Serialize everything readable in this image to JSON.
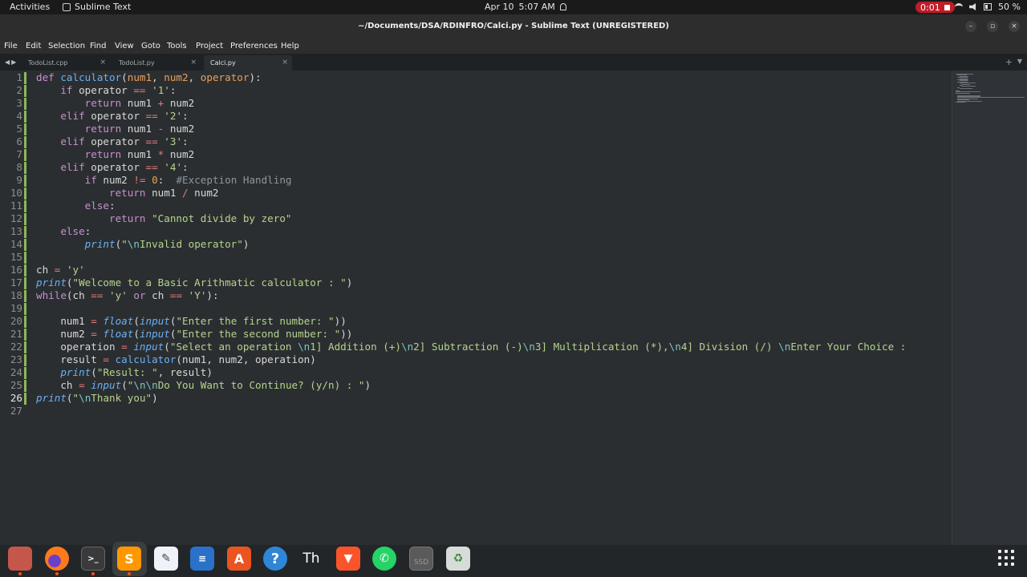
{
  "topbar": {
    "activities": "Activities",
    "app_name": "Sublime Text",
    "date": "Apr 10",
    "time": "5:07 AM",
    "recording_time": "0:01",
    "battery": "50 %",
    "colors": {
      "recording": "#c01c28"
    }
  },
  "window": {
    "title": "~/Documents/DSA/RDINFRO/Calci.py - Sublime Text (UNREGISTERED)",
    "minimize_icon": "minimize-icon",
    "maximize_icon": "maximize-icon",
    "close_icon": "close-icon"
  },
  "menu": [
    "File",
    "Edit",
    "Selection",
    "Find",
    "View",
    "Goto",
    "Tools",
    "Project",
    "Preferences",
    "Help"
  ],
  "tabs": [
    {
      "label": "TodoList.cpp",
      "active": false
    },
    {
      "label": "TodoList.py",
      "active": false
    },
    {
      "label": "Calci.py",
      "active": true
    }
  ],
  "editor": {
    "current_line": 26,
    "line_numbers": [
      "1",
      "2",
      "3",
      "4",
      "5",
      "6",
      "7",
      "8",
      "9",
      "10",
      "11",
      "12",
      "13",
      "14",
      "15",
      "16",
      "17",
      "18",
      "19",
      "20",
      "21",
      "22",
      "23",
      "24",
      "25",
      "26",
      "27"
    ],
    "lines": [
      [
        [
          "k",
          "def"
        ],
        [
          "",
          ""
        ],
        [
          "f",
          " calculator"
        ],
        [
          "",
          "("
        ],
        [
          "p",
          "num1"
        ],
        [
          "",
          ", "
        ],
        [
          "p",
          "num2"
        ],
        [
          "",
          ", "
        ],
        [
          "p",
          "operator"
        ],
        [
          "",
          "):"
        ]
      ],
      [
        [
          "",
          "    "
        ],
        [
          "k",
          "if"
        ],
        [
          "",
          " operator "
        ],
        [
          "o",
          "=="
        ],
        [
          "",
          " "
        ],
        [
          "s",
          "'1'"
        ],
        [
          "",
          ":"
        ]
      ],
      [
        [
          "",
          "        "
        ],
        [
          "k",
          "return"
        ],
        [
          "",
          " num1 "
        ],
        [
          "o",
          "+"
        ],
        [
          "",
          " num2"
        ]
      ],
      [
        [
          "",
          "    "
        ],
        [
          "k",
          "elif"
        ],
        [
          "",
          " operator "
        ],
        [
          "o",
          "=="
        ],
        [
          "",
          " "
        ],
        [
          "s",
          "'2'"
        ],
        [
          "",
          ":"
        ]
      ],
      [
        [
          "",
          "        "
        ],
        [
          "k",
          "return"
        ],
        [
          "",
          " num1 "
        ],
        [
          "o",
          "-"
        ],
        [
          "",
          " num2"
        ]
      ],
      [
        [
          "",
          "    "
        ],
        [
          "k",
          "elif"
        ],
        [
          "",
          " operator "
        ],
        [
          "o",
          "=="
        ],
        [
          "",
          " "
        ],
        [
          "s",
          "'3'"
        ],
        [
          "",
          ":"
        ]
      ],
      [
        [
          "",
          "        "
        ],
        [
          "k",
          "return"
        ],
        [
          "",
          " num1 "
        ],
        [
          "o",
          "*"
        ],
        [
          "",
          " num2"
        ]
      ],
      [
        [
          "",
          "    "
        ],
        [
          "k",
          "elif"
        ],
        [
          "",
          " operator "
        ],
        [
          "o",
          "=="
        ],
        [
          "",
          " "
        ],
        [
          "s",
          "'4'"
        ],
        [
          "",
          ":"
        ]
      ],
      [
        [
          "",
          "        "
        ],
        [
          "k",
          "if"
        ],
        [
          "",
          " num2 "
        ],
        [
          "o",
          "!="
        ],
        [
          "",
          " "
        ],
        [
          "n",
          "0"
        ],
        [
          "",
          ":  "
        ],
        [
          "c",
          "#Exception Handling"
        ]
      ],
      [
        [
          "",
          "            "
        ],
        [
          "k",
          "return"
        ],
        [
          "",
          " num1 "
        ],
        [
          "o",
          "/"
        ],
        [
          "",
          " num2"
        ]
      ],
      [
        [
          "",
          "        "
        ],
        [
          "k",
          "else"
        ],
        [
          "",
          ":"
        ]
      ],
      [
        [
          "",
          "            "
        ],
        [
          "k",
          "return"
        ],
        [
          "",
          " "
        ],
        [
          "s",
          "\"Cannot divide by zero\""
        ]
      ],
      [
        [
          "",
          "    "
        ],
        [
          "k",
          "else"
        ],
        [
          "",
          ":"
        ]
      ],
      [
        [
          "",
          "        "
        ],
        [
          "bi",
          "print"
        ],
        [
          "",
          "("
        ],
        [
          "s",
          "\""
        ],
        [
          "e",
          "\\n"
        ],
        [
          "s",
          "Invalid operator\""
        ],
        [
          "",
          ")"
        ]
      ],
      [
        [
          "",
          ""
        ]
      ],
      [
        [
          "",
          "ch "
        ],
        [
          "o",
          "="
        ],
        [
          "",
          " "
        ],
        [
          "s",
          "'y'"
        ]
      ],
      [
        [
          "bi",
          "print"
        ],
        [
          "",
          "("
        ],
        [
          "s",
          "\"Welcome to a Basic Arithmatic calculator : \""
        ],
        [
          "",
          ")"
        ]
      ],
      [
        [
          "k",
          "while"
        ],
        [
          "",
          "(ch "
        ],
        [
          "o",
          "=="
        ],
        [
          "",
          " "
        ],
        [
          "s",
          "'y'"
        ],
        [
          "",
          " "
        ],
        [
          "k",
          "or"
        ],
        [
          "",
          " ch "
        ],
        [
          "o",
          "=="
        ],
        [
          "",
          " "
        ],
        [
          "s",
          "'Y'"
        ],
        [
          "",
          "):"
        ]
      ],
      [
        [
          "",
          ""
        ]
      ],
      [
        [
          "",
          "    num1 "
        ],
        [
          "o",
          "="
        ],
        [
          "",
          " "
        ],
        [
          "bi",
          "float"
        ],
        [
          "",
          "("
        ],
        [
          "bi",
          "input"
        ],
        [
          "",
          "("
        ],
        [
          "s",
          "\"Enter the first number: \""
        ],
        [
          "",
          "))"
        ]
      ],
      [
        [
          "",
          "    num2 "
        ],
        [
          "o",
          "="
        ],
        [
          "",
          " "
        ],
        [
          "bi",
          "float"
        ],
        [
          "",
          "("
        ],
        [
          "bi",
          "input"
        ],
        [
          "",
          "("
        ],
        [
          "s",
          "\"Enter the second number: \""
        ],
        [
          "",
          "))"
        ]
      ],
      [
        [
          "",
          "    operation "
        ],
        [
          "o",
          "="
        ],
        [
          "",
          " "
        ],
        [
          "bi",
          "input"
        ],
        [
          "",
          "("
        ],
        [
          "s",
          "\"Select an operation "
        ],
        [
          "e",
          "\\n"
        ],
        [
          "s",
          "1] Addition (+)"
        ],
        [
          "e",
          "\\n"
        ],
        [
          "s",
          "2] Subtraction (-)"
        ],
        [
          "e",
          "\\n"
        ],
        [
          "s",
          "3] Multiplication (*),"
        ],
        [
          "e",
          "\\n"
        ],
        [
          "s",
          "4] Division (/) "
        ],
        [
          "e",
          "\\n"
        ],
        [
          "s",
          "Enter Your Choice :"
        ]
      ],
      [
        [
          "",
          "    result "
        ],
        [
          "o",
          "="
        ],
        [
          "",
          " "
        ],
        [
          "f",
          "calculator"
        ],
        [
          "",
          "(num1, num2, operation)"
        ]
      ],
      [
        [
          "",
          "    "
        ],
        [
          "bi",
          "print"
        ],
        [
          "",
          "("
        ],
        [
          "s",
          "\"Result: \""
        ],
        [
          "",
          ", result)"
        ]
      ],
      [
        [
          "",
          "    ch "
        ],
        [
          "o",
          "="
        ],
        [
          "",
          " "
        ],
        [
          "bi",
          "input"
        ],
        [
          "",
          "("
        ],
        [
          "s",
          "\""
        ],
        [
          "e",
          "\\n\\n"
        ],
        [
          "s",
          "Do You Want to Continue? (y/n) : \""
        ],
        [
          "",
          ")"
        ]
      ],
      [
        [
          "bi",
          "print"
        ],
        [
          "",
          "("
        ],
        [
          "s",
          "\""
        ],
        [
          "e",
          "\\n"
        ],
        [
          "s",
          "Thank you\""
        ],
        [
          "",
          ")"
        ]
      ],
      [
        [
          "",
          ""
        ]
      ]
    ],
    "colors": {
      "background": "#2b2e31",
      "keyword": "#c78fd0",
      "string": "#b5d48b",
      "function": "#6ab0f3"
    }
  },
  "dock": {
    "apps": [
      "files-icon",
      "firefox-icon",
      "terminal-icon",
      "sublime-text-icon",
      "text-editor-icon",
      "libreoffice-writer-icon",
      "software-center-icon",
      "help-icon",
      "typography-icon",
      "brave-browser-icon",
      "whatsapp-icon",
      "ssd-drive-icon",
      "trash-icon"
    ],
    "ssd_label": "SSD",
    "typography_label": "Th",
    "help_label": "?",
    "apps_grid_icon": "show-applications-icon"
  }
}
